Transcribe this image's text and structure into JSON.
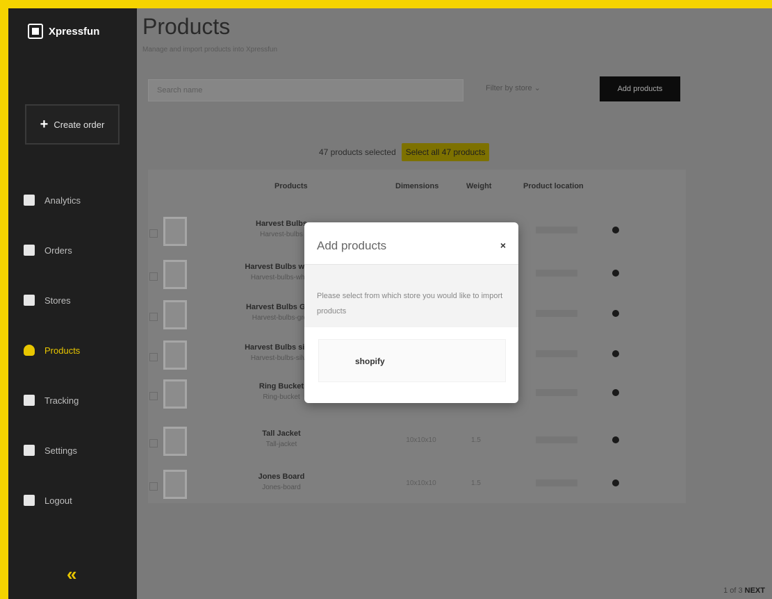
{
  "app": {
    "name": "Xpressfun"
  },
  "sidebar": {
    "create_label": "Create order",
    "items": [
      {
        "label": "Analytics",
        "icon": "analytics-icon"
      },
      {
        "label": "Orders",
        "icon": "orders-icon"
      },
      {
        "label": "Stores",
        "icon": "stores-icon"
      },
      {
        "label": "Products",
        "icon": "products-icon",
        "active": true
      },
      {
        "label": "Tracking",
        "icon": "tracking-icon"
      },
      {
        "label": "Settings",
        "icon": "settings-icon"
      },
      {
        "label": "Logout",
        "icon": "logout-icon"
      }
    ],
    "collapse_icon": "collapse-icon",
    "accent": "#e8c600"
  },
  "header": {
    "title": "Products",
    "subtitle": "Manage and import products into Xpressfun"
  },
  "toolbar": {
    "search_placeholder": "Search name",
    "filter_label": "Filter by store",
    "add_label": "Add products"
  },
  "selection": {
    "text": "47 products selected",
    "select_all": "Select all 47 products"
  },
  "table": {
    "columns": [
      "Products",
      "Dimensions",
      "Weight",
      "Product location"
    ],
    "rows": [
      {
        "name": "Harvest Bulbs",
        "sku": "Harvest-bulbs",
        "dimensions": "",
        "weight": ""
      },
      {
        "name": "Harvest Bulbs white",
        "sku": "Harvest-bulbs-white",
        "dimensions": "",
        "weight": ""
      },
      {
        "name": "Harvest Bulbs Grey",
        "sku": "Harvest-bulbs-grey",
        "dimensions": "",
        "weight": ""
      },
      {
        "name": "Harvest Bulbs silver",
        "sku": "Harvest-bulbs-silver",
        "dimensions": "",
        "weight": ""
      },
      {
        "name": "Ring Bucket",
        "sku": "Ring-bucket",
        "dimensions": "",
        "weight": ""
      },
      {
        "name": "Tall Jacket",
        "sku": "Tall-jacket",
        "dimensions": "10x10x10",
        "weight": "1.5"
      },
      {
        "name": "Jones Board",
        "sku": "Jones-board",
        "dimensions": "10x10x10",
        "weight": "1.5"
      }
    ]
  },
  "pagination": {
    "text": "1 of 3",
    "next": "NEXT"
  },
  "modal": {
    "title": "Add products",
    "close": "×",
    "text": "Please select from which store you would like to import products",
    "option": "shopify"
  }
}
